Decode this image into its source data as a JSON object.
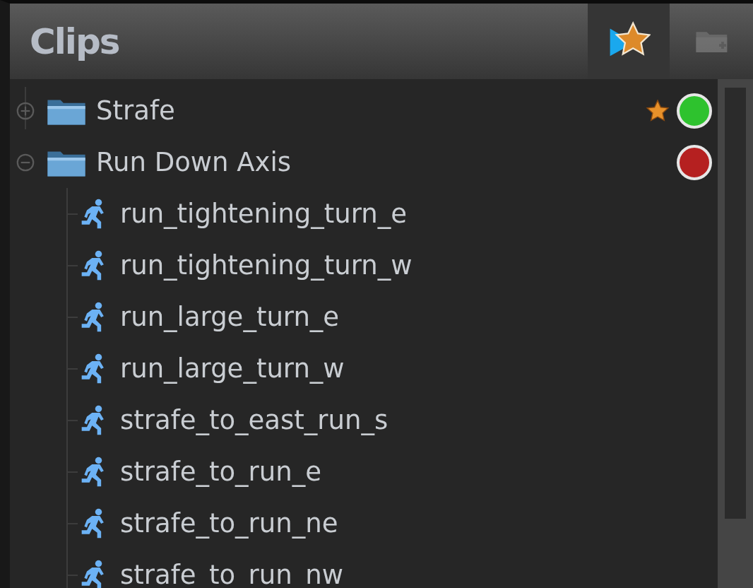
{
  "panel": {
    "title": "Clips"
  },
  "tabs": [
    {
      "kind": "favorites",
      "selected": true
    },
    {
      "kind": "folder",
      "selected": false
    }
  ],
  "tree": [
    {
      "label": "Strafe",
      "expanded": false,
      "favorite": true,
      "color": "#2ec22e"
    },
    {
      "label": "Run Down Axis",
      "expanded": true,
      "favorite": false,
      "color": "#b52020",
      "children": [
        {
          "label": "run_tightening_turn_e"
        },
        {
          "label": "run_tightening_turn_w"
        },
        {
          "label": "run_large_turn_e"
        },
        {
          "label": "run_large_turn_w"
        },
        {
          "label": "strafe_to_east_run_s"
        },
        {
          "label": "strafe_to_run_e"
        },
        {
          "label": "strafe_to_run_ne"
        },
        {
          "label": "strafe_to_run_nw"
        }
      ]
    }
  ]
}
